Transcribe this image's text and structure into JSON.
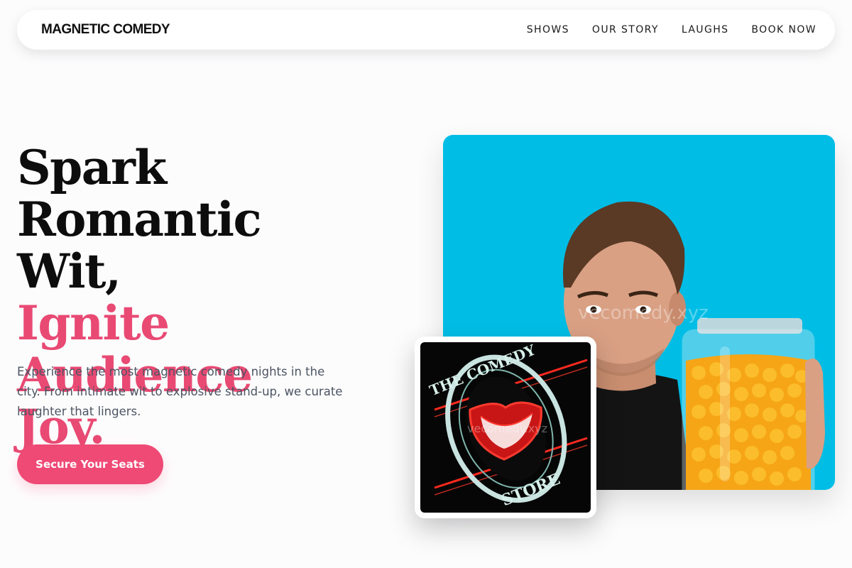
{
  "brand": {
    "name": "MAGNETIC COMEDY"
  },
  "nav": {
    "items": [
      {
        "label": "SHOWS"
      },
      {
        "label": "OUR STORY"
      },
      {
        "label": "LAUGHS"
      },
      {
        "label": "BOOK NOW"
      }
    ]
  },
  "hero": {
    "headline_line1": "Spark Romantic",
    "headline_line2": "Wit,",
    "headline_line3": "Ignite Audience",
    "headline_line4": "Joy.",
    "description": "Experience the most magnetic comedy nights in the city. From intimate wit to explosive stand-up, we curate laughter that lingers.",
    "cta_label": "Secure Your Seats"
  },
  "images": {
    "main_watermark": "vecomedy.xyz",
    "inset_watermark": "vecomedy.xyz",
    "sign_text_top": "THE COMEDY",
    "sign_text_bottom": "STORE"
  },
  "colors": {
    "accent": "#ef4a75",
    "headline_pink": "#e84a73",
    "photo_bg": "#00bde5",
    "text_muted": "#4b5563"
  }
}
